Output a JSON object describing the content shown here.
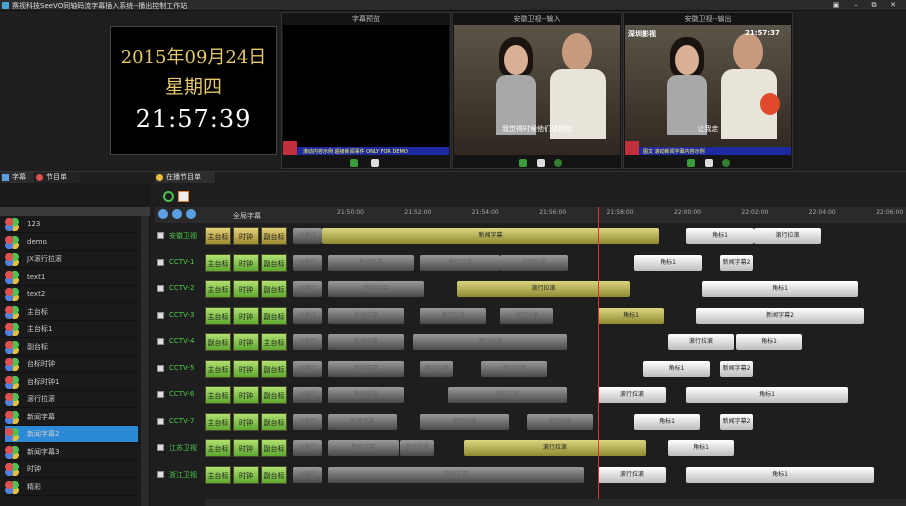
{
  "app": {
    "title": "赛视科技SeeVO同轴码流字幕插入系统--播出控制工作站"
  },
  "window": {
    "min": "▣",
    "restore": "–",
    "max": "⧉",
    "close": "✕"
  },
  "clock": {
    "date": "2015年09月24日",
    "weekday": "星期四",
    "time": "21:57:39"
  },
  "previews": [
    {
      "caption": "字幕预览",
      "ticker": "滚动内容示例   超级新闻事件 ONLY FOR DEMO",
      "scene": "blank"
    },
    {
      "caption": "安徽卫视--输入",
      "subtitle": "我觉得时候他们是把我",
      "scene": "people"
    },
    {
      "caption": "安徽卫视--输出",
      "logo": "深圳影视",
      "clock": "21:57:37",
      "subtitle": "让我走",
      "ticker": "图文  滚动新闻字幕内容示例",
      "scene": "people"
    }
  ],
  "tabs": {
    "left": [
      "字幕",
      "节目单"
    ],
    "right": "在播节目单"
  },
  "library": [
    "123",
    "demo",
    "JX滚行拉滚",
    "text1",
    "text2",
    "主台标",
    "主台标1",
    "副台标",
    "台标时钟",
    "台标时钟1",
    "滚行拉滚",
    "新闻字幕",
    "新闻字幕2",
    "新闻字幕3",
    "时钟",
    "精彩"
  ],
  "library_selected": 12,
  "timeline": {
    "header": "全局字幕",
    "ticks": [
      "21:50:00",
      "21:52:00",
      "21:54:00",
      "21:56:00",
      "21:58:00",
      "22:00:00",
      "22:02:00",
      "22:04:00",
      "22:06:00"
    ]
  },
  "channels": [
    {
      "name": "安徽卫视",
      "buttons": [
        "主台标",
        "时钟",
        "副台标"
      ],
      "clips": [
        {
          "l": 293,
          "w": 29,
          "c": "grey",
          "t": "JX滚行"
        },
        {
          "l": 322,
          "w": 337,
          "c": "gold",
          "t": "新闻字幕"
        },
        {
          "l": 686,
          "w": 68,
          "c": "white",
          "t": "角标1"
        },
        {
          "l": 754,
          "w": 67,
          "c": "white",
          "t": "滚行拉滚"
        }
      ]
    },
    {
      "name": "CCTV-1",
      "buttons": [
        "主台标",
        "时钟",
        "副台标"
      ],
      "clips": [
        {
          "l": 293,
          "w": 29,
          "c": "grey",
          "t": "JX滚行"
        },
        {
          "l": 328,
          "w": 86,
          "c": "grey",
          "t": "新闻字幕"
        },
        {
          "l": 420,
          "w": 80,
          "c": "grey",
          "t": "滚行拉滚"
        },
        {
          "l": 500,
          "w": 68,
          "c": "grey",
          "t": "滚行拉滚"
        },
        {
          "l": 634,
          "w": 68,
          "c": "white",
          "t": "角标1"
        },
        {
          "l": 720,
          "w": 33,
          "c": "white",
          "t": "新闻字幕2"
        }
      ]
    },
    {
      "name": "CCTV-2",
      "buttons": [
        "主台标",
        "时钟",
        "副台标"
      ],
      "clips": [
        {
          "l": 293,
          "w": 29,
          "c": "grey",
          "t": "JX滚行"
        },
        {
          "l": 328,
          "w": 96,
          "c": "grey",
          "t": "新闻字幕"
        },
        {
          "l": 457,
          "w": 173,
          "c": "gold",
          "t": "滚行拉滚"
        },
        {
          "l": 702,
          "w": 156,
          "c": "white",
          "t": "角标1"
        }
      ]
    },
    {
      "name": "CCTV-3",
      "buttons": [
        "主台标",
        "时钟",
        "副台标"
      ],
      "clips": [
        {
          "l": 293,
          "w": 29,
          "c": "grey",
          "t": "JX滚行"
        },
        {
          "l": 328,
          "w": 76,
          "c": "grey",
          "t": "新闻字幕"
        },
        {
          "l": 420,
          "w": 66,
          "c": "grey",
          "t": "滚行拉滚"
        },
        {
          "l": 500,
          "w": 53,
          "c": "grey",
          "t": "滚行拉滚"
        },
        {
          "l": 598,
          "w": 66,
          "c": "gold",
          "t": "角标1"
        },
        {
          "l": 696,
          "w": 168,
          "c": "white",
          "t": "新闻字幕2"
        }
      ]
    },
    {
      "name": "CCTV-4",
      "buttons": [
        "副台标",
        "时钟",
        "主台标"
      ],
      "clips": [
        {
          "l": 293,
          "w": 29,
          "c": "grey",
          "t": "JX滚行"
        },
        {
          "l": 328,
          "w": 76,
          "c": "grey",
          "t": "新闻字幕"
        },
        {
          "l": 413,
          "w": 154,
          "c": "grey",
          "t": "滚行拉滚"
        },
        {
          "l": 668,
          "w": 66,
          "c": "white",
          "t": "滚行拉滚"
        },
        {
          "l": 736,
          "w": 66,
          "c": "white",
          "t": "角标1"
        }
      ]
    },
    {
      "name": "CCTV-5",
      "buttons": [
        "主台标",
        "时钟",
        "副台标"
      ],
      "clips": [
        {
          "l": 293,
          "w": 29,
          "c": "grey",
          "t": "JX滚行"
        },
        {
          "l": 328,
          "w": 76,
          "c": "grey",
          "t": "新闻字幕"
        },
        {
          "l": 420,
          "w": 33,
          "c": "grey",
          "t": "滚行拉滚"
        },
        {
          "l": 481,
          "w": 66,
          "c": "grey",
          "t": "滚行拉滚"
        },
        {
          "l": 643,
          "w": 67,
          "c": "white",
          "t": "角标1"
        },
        {
          "l": 720,
          "w": 33,
          "c": "white",
          "t": "新闻字幕2"
        }
      ]
    },
    {
      "name": "CCTV-6",
      "buttons": [
        "主台标",
        "时钟",
        "副台标"
      ],
      "clips": [
        {
          "l": 293,
          "w": 29,
          "c": "grey",
          "t": "JX滚行"
        },
        {
          "l": 328,
          "w": 76,
          "c": "grey",
          "t": "新闻字幕"
        },
        {
          "l": 448,
          "w": 119,
          "c": "grey",
          "t": "滚行拉滚"
        },
        {
          "l": 598,
          "w": 68,
          "c": "white",
          "t": "滚行拉滚"
        },
        {
          "l": 686,
          "w": 162,
          "c": "white",
          "t": "角标1"
        }
      ]
    },
    {
      "name": "CCTV-7",
      "buttons": [
        "主台标",
        "时钟",
        "副台标"
      ],
      "clips": [
        {
          "l": 293,
          "w": 29,
          "c": "grey",
          "t": "JX滚行"
        },
        {
          "l": 328,
          "w": 69,
          "c": "grey",
          "t": "新闻字幕"
        },
        {
          "l": 420,
          "w": 89,
          "c": "grey",
          "t": "滚行拉滚"
        },
        {
          "l": 527,
          "w": 66,
          "c": "grey",
          "t": "滚行拉滚"
        },
        {
          "l": 634,
          "w": 66,
          "c": "white",
          "t": "角标1"
        },
        {
          "l": 720,
          "w": 33,
          "c": "white",
          "t": "新闻字幕2"
        }
      ]
    },
    {
      "name": "江苏卫视",
      "buttons": [
        "主台标",
        "时钟",
        "副台标"
      ],
      "clips": [
        {
          "l": 293,
          "w": 29,
          "c": "grey",
          "t": "JX滚行"
        },
        {
          "l": 328,
          "w": 71,
          "c": "grey",
          "t": "新闻字幕"
        },
        {
          "l": 400,
          "w": 34,
          "c": "grey",
          "t": "滚行拉滚"
        },
        {
          "l": 464,
          "w": 182,
          "c": "gold",
          "t": "滚行拉滚"
        },
        {
          "l": 668,
          "w": 66,
          "c": "white",
          "t": "角标1"
        }
      ]
    },
    {
      "name": "浙江卫视",
      "buttons": [
        "主台标",
        "时钟",
        "副台标"
      ],
      "clips": [
        {
          "l": 293,
          "w": 29,
          "c": "grey",
          "t": "JX滚行"
        },
        {
          "l": 328,
          "w": 256,
          "c": "grey",
          "t": "新闻字幕"
        },
        {
          "l": 598,
          "w": 68,
          "c": "white",
          "t": "滚行拉滚"
        },
        {
          "l": 686,
          "w": 188,
          "c": "white",
          "t": "角标1"
        }
      ]
    }
  ]
}
